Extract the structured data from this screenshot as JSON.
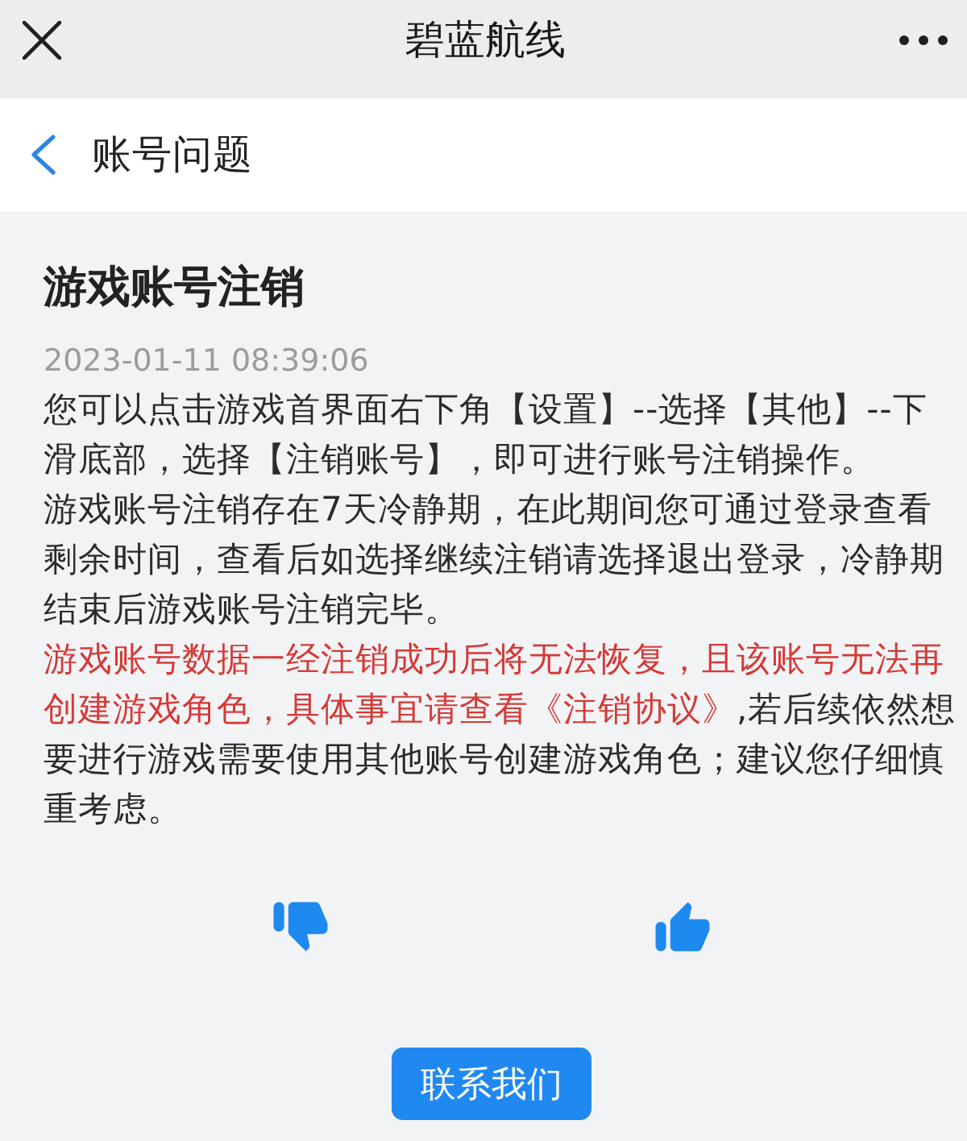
{
  "top_bar": {
    "title": "碧蓝航线"
  },
  "nav_bar": {
    "title": "账号问题"
  },
  "article": {
    "title": "游戏账号注销",
    "date": "2023-01-11 08:39:06",
    "paragraphs": [
      {
        "segments": [
          {
            "kind": "normal",
            "text": "您可以点击游戏首界面右下角【设置】--选择【其他】--下滑底部，选择【注销账号】，即可进行账号注销操作。"
          }
        ]
      },
      {
        "segments": [
          {
            "kind": "normal",
            "text": "游戏账号注销存在7天冷静期，在此期间您可通过登录查看剩余时间，查看后如选择继续注销请选择退出登录，冷静期结束后游戏账号注销完毕。"
          }
        ]
      },
      {
        "segments": [
          {
            "kind": "warning",
            "text": "游戏账号数据一经注销成功后将无法恢复，且该账号无法再创建游戏角色，具体事宜请查看《注销协议》"
          },
          {
            "kind": "normal",
            "text": ",若后续依然想要进行游戏需要使用其他账号创建游戏角色；建议您仔细慎重考虑。"
          }
        ]
      }
    ]
  },
  "contact_button": {
    "label": "联系我们"
  }
}
